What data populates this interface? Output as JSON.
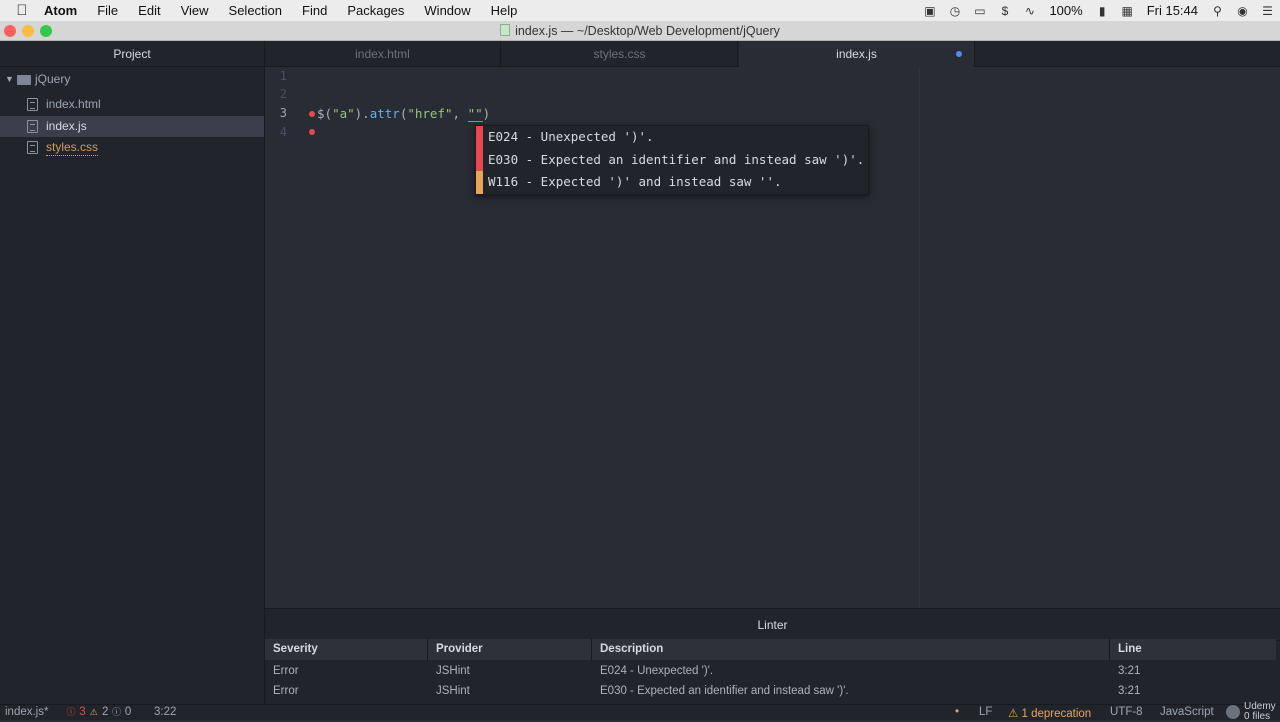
{
  "menubar": {
    "app_name": "Atom",
    "items": [
      "File",
      "Edit",
      "View",
      "Selection",
      "Find",
      "Packages",
      "Window",
      "Help"
    ],
    "battery": "100%",
    "clock": "Fri 15:44"
  },
  "window": {
    "title": "index.js — ~/Desktop/Web Development/jQuery"
  },
  "sidebar": {
    "header": "Project",
    "folder": "jQuery",
    "files": [
      "index.html",
      "index.js",
      "styles.css"
    ]
  },
  "tabs": [
    "index.html",
    "styles.css",
    "index.js"
  ],
  "editor": {
    "line_numbers": [
      "1",
      "2",
      "3",
      "4"
    ],
    "code": {
      "t1": "$(",
      "t2": "\"a\"",
      "t3": ").",
      "t4": "attr",
      "t5": "(",
      "t6": "\"href\"",
      "t7": ", ",
      "t8": "\"\"",
      "t9": ")"
    },
    "tooltip": [
      "E024 - Unexpected ')'.",
      "E030 - Expected an identifier and instead saw ')'.",
      "W116 - Expected ')' and instead saw ''."
    ]
  },
  "linter": {
    "title": "Linter",
    "headers": [
      "Severity",
      "Provider",
      "Description",
      "Line"
    ],
    "rows": [
      [
        "Error",
        "JSHint",
        "E024 - Unexpected ')'.",
        "3:21"
      ],
      [
        "Error",
        "JSHint",
        "E030 - Expected an identifier and instead saw ')'.",
        "3:21"
      ]
    ]
  },
  "statusbar": {
    "file": "index.js*",
    "errors": "3",
    "warnings": "2",
    "infos": "0",
    "cursor": "3:22",
    "line_ending": "LF",
    "deprecation": "1 deprecation",
    "encoding": "UTF-8",
    "grammar": "JavaScript"
  },
  "watermark": {
    "brand": "Udemy",
    "files": "0 files"
  },
  "colors": {
    "error": "#e5484d",
    "warning": "#e5a65a",
    "accent": "#568af2"
  }
}
